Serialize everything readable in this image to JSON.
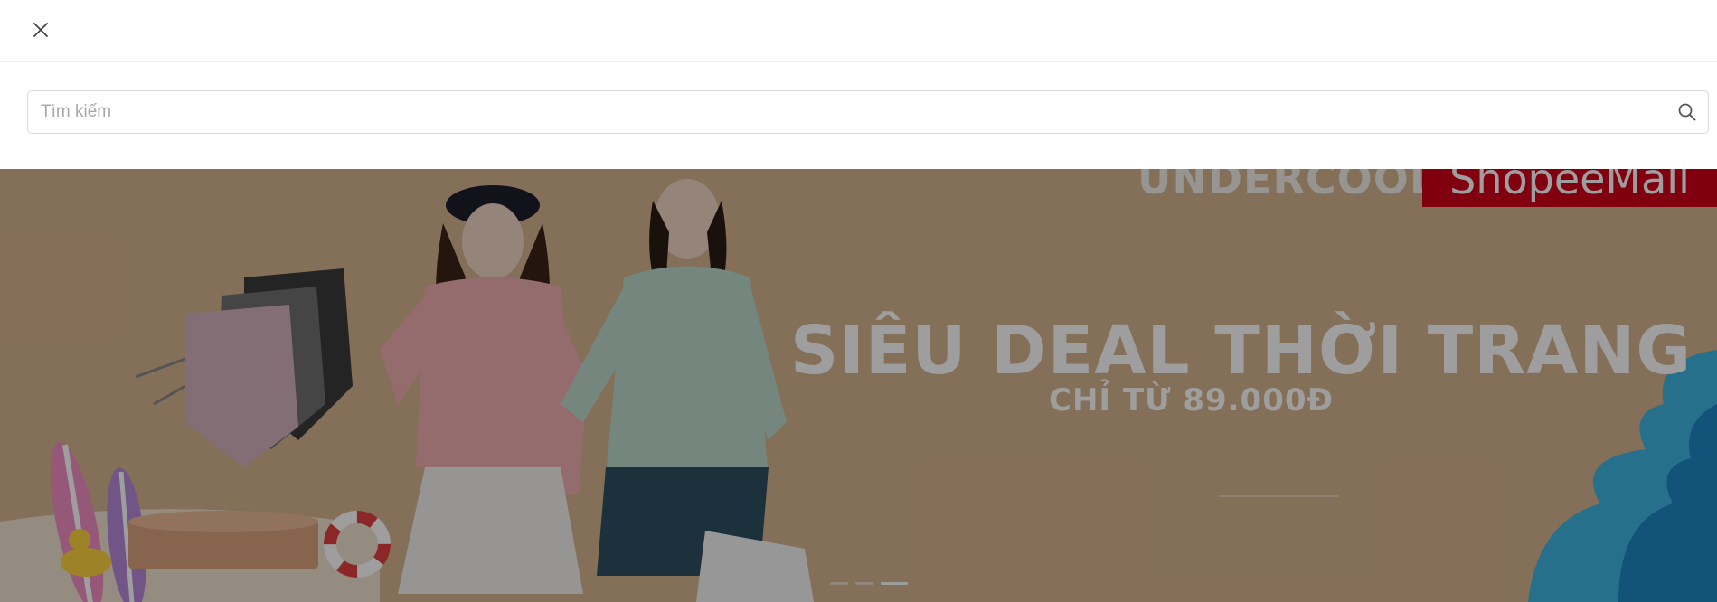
{
  "header": {
    "close_icon": "close-icon"
  },
  "search": {
    "placeholder": "Tìm kiếm",
    "value": "",
    "button_icon": "search-icon"
  },
  "banner": {
    "brand": "UNDERCOOL",
    "mall_badge": "ShopeeMall",
    "headline": "SIÊU DEAL THỜI TRANG",
    "subline": "CHỈ TỪ 89.000Đ",
    "slides_total": 3,
    "active_slide": 3,
    "background_color": "#d6b38f",
    "overlay_color": "rgba(0,0,0,0.38)"
  }
}
